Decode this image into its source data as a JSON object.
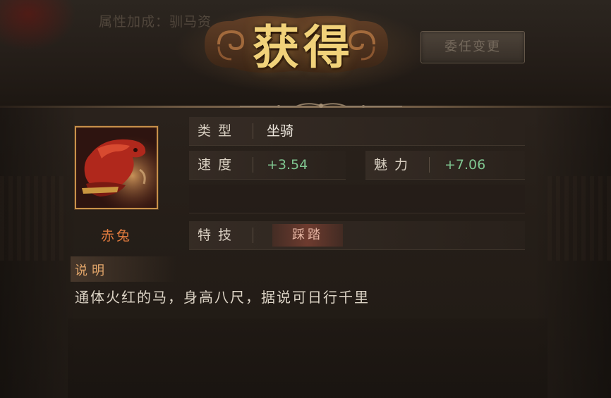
{
  "header": {
    "background_attr_text": "属性加成：驯马资",
    "title": "获得",
    "change_button_label": "委任变更"
  },
  "item": {
    "name": "赤兔",
    "icon": "red-hare-horse-icon"
  },
  "stats": {
    "type_label": "类型",
    "type_value": "坐骑",
    "speed_label": "速度",
    "speed_value": "+3.54",
    "charm_label": "魅力",
    "charm_value": "+7.06",
    "skill_label": "特技",
    "skill_value": "踩踏"
  },
  "description": {
    "label": "说明",
    "text": "通体火红的马，身高八尺，据说可日行千里"
  },
  "colors": {
    "title_gold": "#f1d27a",
    "item_name_orange": "#e07a3e",
    "bonus_green": "#7fc590",
    "frame_gold": "#c8914a"
  }
}
